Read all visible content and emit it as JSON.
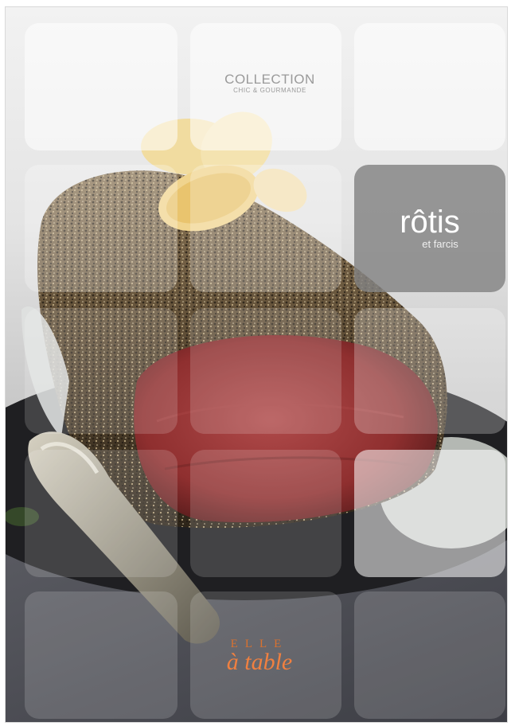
{
  "cover": {
    "collection": "COLLECTION",
    "collection_sub": "CHIC & GOURMANDE",
    "title": "rôtis",
    "subtitle": "et farcis",
    "brand_top": "ELLE",
    "brand": "à table"
  },
  "colors": {
    "meat": "#8f2f2f",
    "crust": "#5b4a33",
    "plate": "#1f1f22",
    "board": "#4a4b52",
    "title_tile": "#828282",
    "brand": "#f08040"
  },
  "icons": [
    "roast-beef-illustration",
    "knife-illustration",
    "lemon-slice-illustration"
  ]
}
